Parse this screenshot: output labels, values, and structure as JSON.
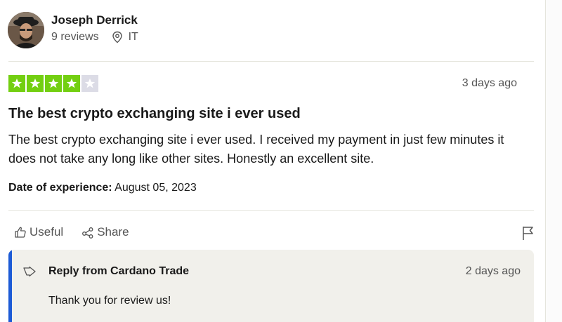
{
  "reviewer": {
    "name": "Joseph Derrick",
    "reviews": "9 reviews",
    "country": "IT"
  },
  "review": {
    "rating": 4,
    "max_rating": 5,
    "star_color": "#73cf11",
    "empty_star_color": "#dcdce6",
    "date": "3 days ago",
    "title": "The best crypto exchanging site i ever used",
    "body": "The best crypto exchanging site i ever used. I received my payment in just few minutes it does not take any long like other sites. Honestly an excellent site.",
    "experience_label": "Date of experience:",
    "experience_date": "August 05, 2023"
  },
  "actions": {
    "useful": "Useful",
    "share": "Share"
  },
  "reply": {
    "from": "Reply from Cardano Trade",
    "date": "2 days ago",
    "text": "Thank you for review us!",
    "accent": "#1d5bd6"
  }
}
